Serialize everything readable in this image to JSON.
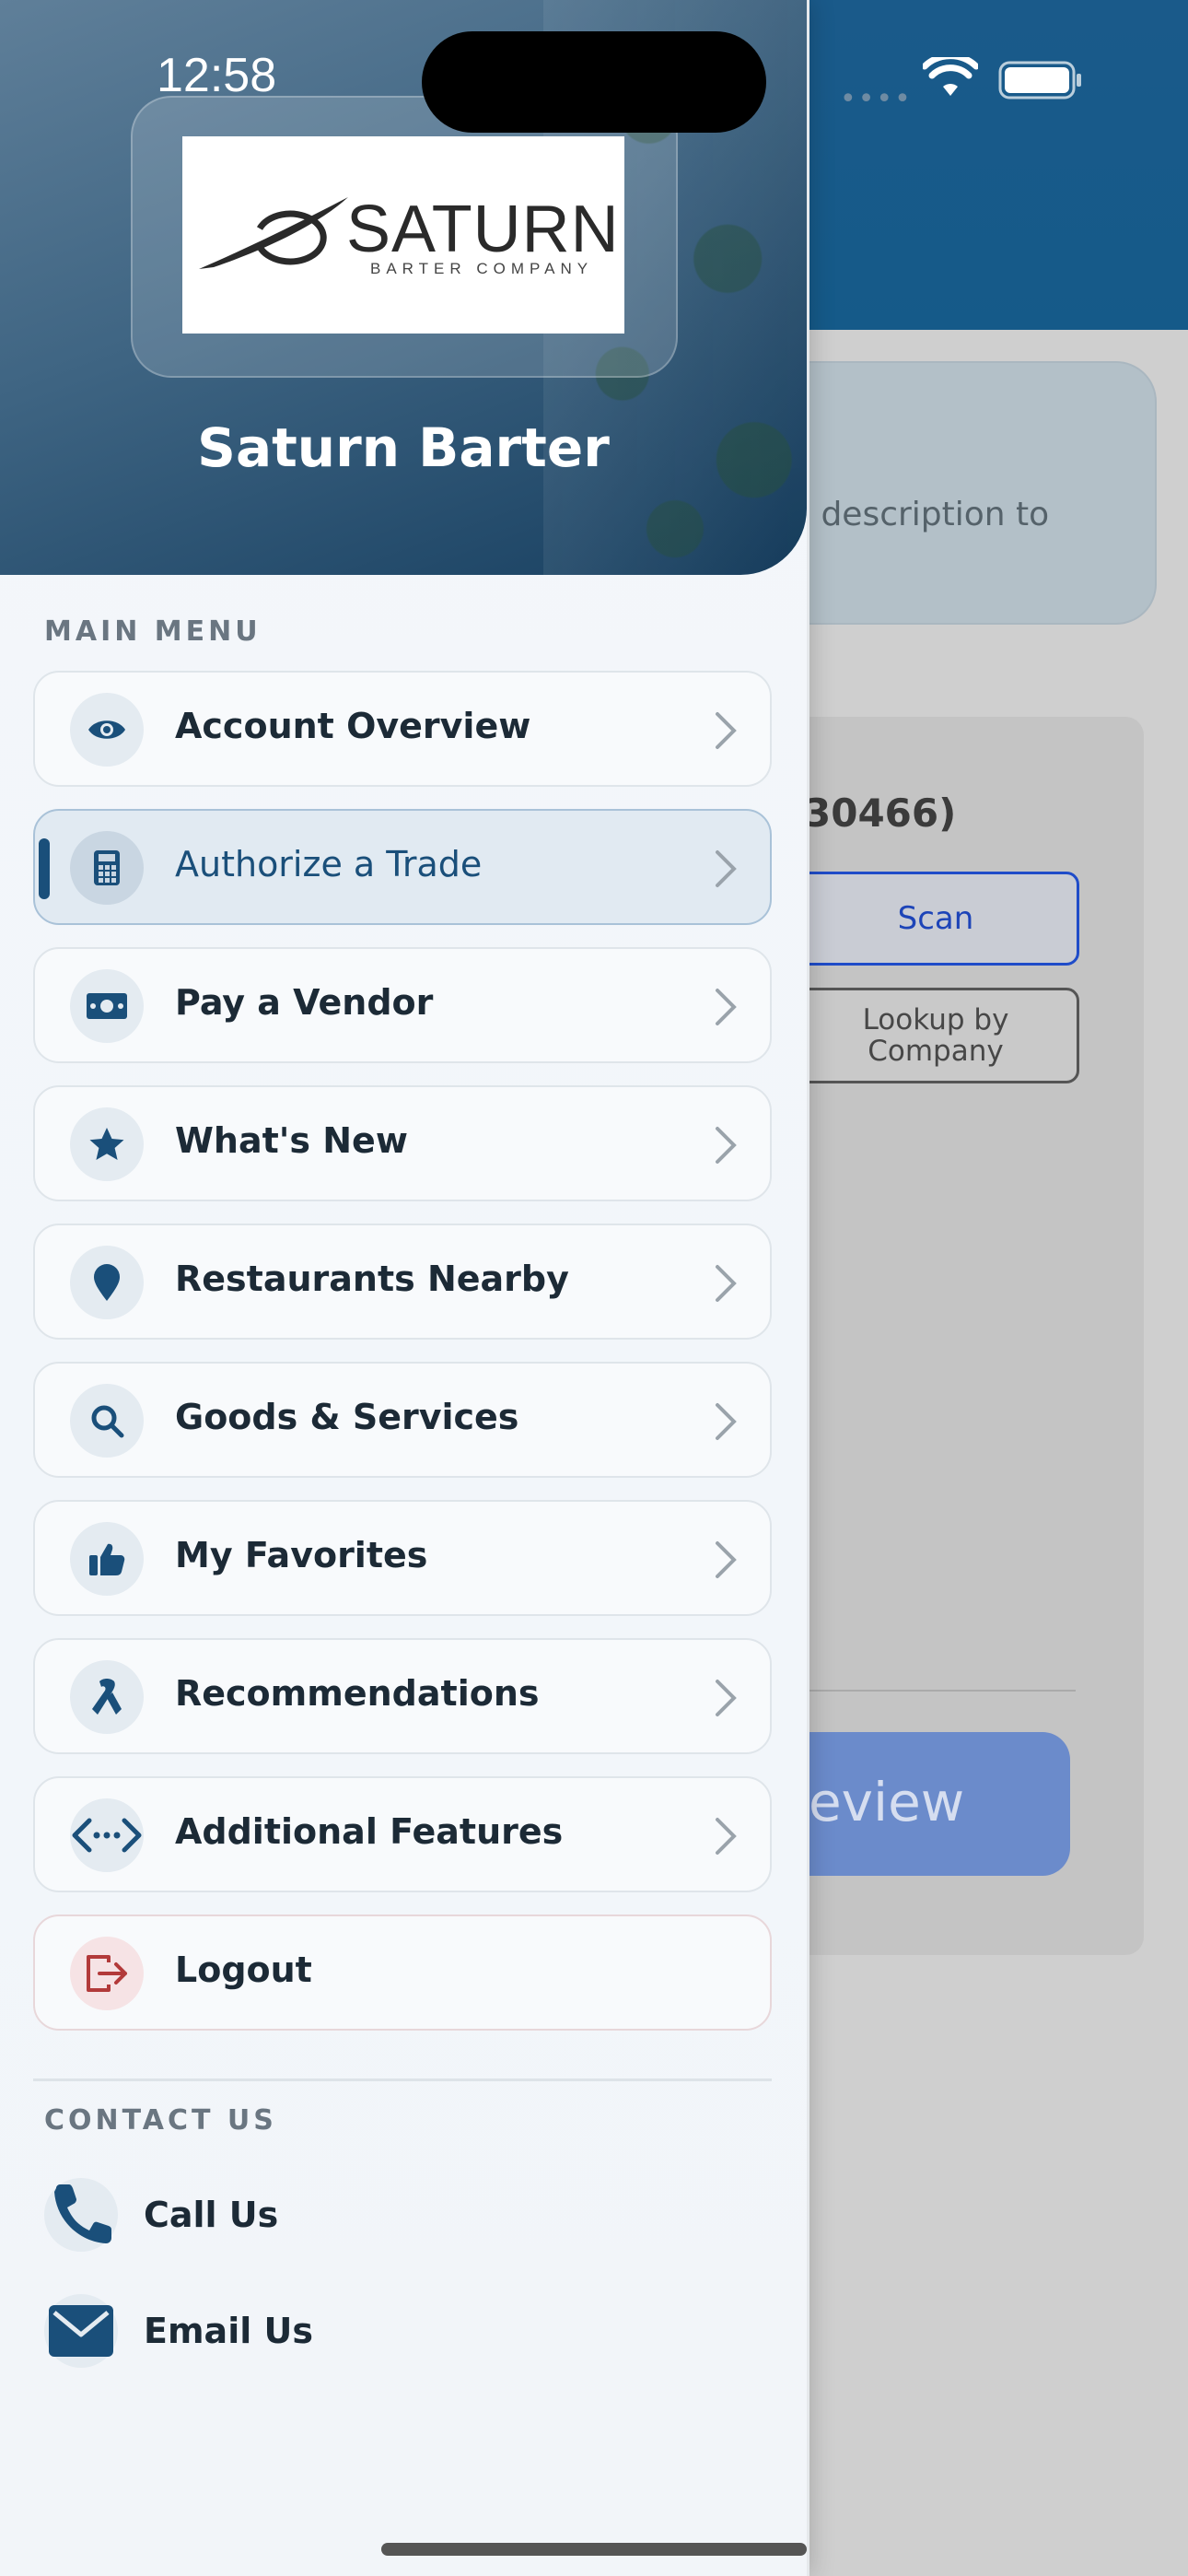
{
  "status_bar": {
    "time": "12:58"
  },
  "drawer": {
    "logo": {
      "wordmark": "SATURN",
      "tagline": "BARTER COMPANY"
    },
    "company_name": "Saturn Barter",
    "main_menu_label": "MAIN MENU",
    "items": [
      {
        "label": "Account Overview",
        "icon": "eye-icon"
      },
      {
        "label": "Authorize a Trade",
        "icon": "calculator-icon",
        "active": true
      },
      {
        "label": "Pay a Vendor",
        "icon": "money-bill-icon"
      },
      {
        "label": "What's New",
        "icon": "star-icon"
      },
      {
        "label": "Restaurants Nearby",
        "icon": "map-pin-icon"
      },
      {
        "label": "Goods & Services",
        "icon": "search-icon"
      },
      {
        "label": "My Favorites",
        "icon": "thumbs-up-icon"
      },
      {
        "label": "Recommendations",
        "icon": "ribbon-icon"
      },
      {
        "label": "Additional Features",
        "icon": "code-arrows-icon"
      },
      {
        "label": "Logout",
        "icon": "logout-icon"
      }
    ],
    "contact_label": "CONTACT US",
    "contact": [
      {
        "label": "Call Us",
        "icon": "phone-icon"
      },
      {
        "label": "Email Us",
        "icon": "envelope-icon"
      }
    ]
  },
  "background_page": {
    "info_text": "l description to",
    "account_number": "30466)",
    "scan_label": "Scan",
    "lookup_label": "Lookup by Company",
    "review_label": "eview"
  },
  "colors": {
    "accent": "#1a4f7a",
    "header_blue": "#155a89",
    "logout_red": "#b23a3a"
  }
}
